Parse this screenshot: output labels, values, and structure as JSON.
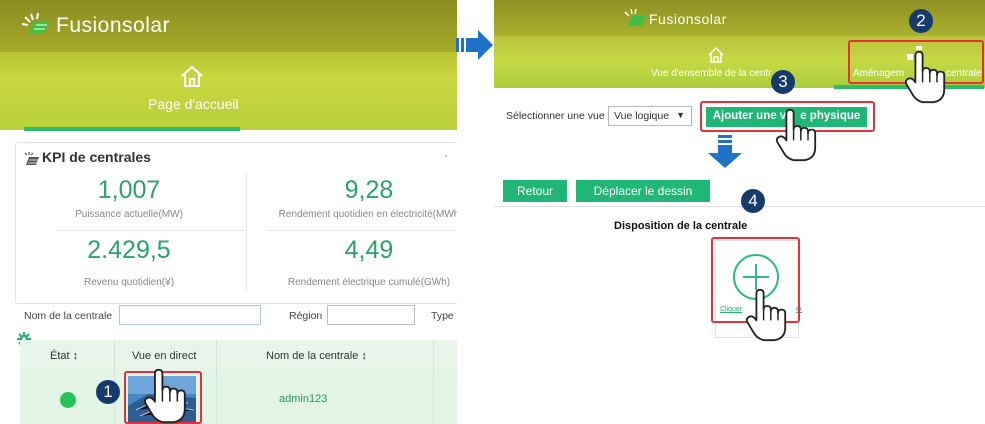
{
  "colors": {
    "accent_green": "#1fb676",
    "kpi_green": "#2aa36a",
    "highlight_red": "#e8303a",
    "badge_navy": "#173a6c",
    "header_olive": "#a6ab2a"
  },
  "left": {
    "app_title": "Fusionsolar",
    "home_tab": "Page d'accueil",
    "kpi": {
      "title": "KPI de centrales",
      "more": "·",
      "items": [
        {
          "value": "1,007",
          "label": "Puissance actuelle(MW)"
        },
        {
          "value": "9,28",
          "label": "Rendement quotidien en électricité(MWh"
        },
        {
          "value": "2.429,5",
          "label": "Revenu quotidien(¥)"
        },
        {
          "value": "4,49",
          "label": "Rendement électrique cumulé(GWh)"
        }
      ]
    },
    "filters": {
      "plant_name_label": "Nom de la centrale",
      "region_label": "Région",
      "type_label": "Type"
    },
    "table": {
      "columns": [
        "État ↕",
        "Vue en direct",
        "Nom de la centrale ↕"
      ],
      "row": {
        "plant_name": "admin123"
      }
    }
  },
  "right": {
    "app_title": "Fusionsolar",
    "tab_overview": "Vue d'ensemble de la centr",
    "tab_layout_a": "Aménagem",
    "tab_layout_b": "centrale",
    "select_label": "Sélectionner une vue",
    "select_value": "Vue logique",
    "add_physical_a": "Ajouter une v",
    "add_physical_b": "e physique",
    "back_button": "Retour",
    "move_button": "Déplacer le dessin",
    "layout_title": "Disposition de la centrale",
    "click_add_a": "Cliquer",
    "click_add_b": "er"
  },
  "steps": [
    "1",
    "2",
    "3",
    "4"
  ]
}
